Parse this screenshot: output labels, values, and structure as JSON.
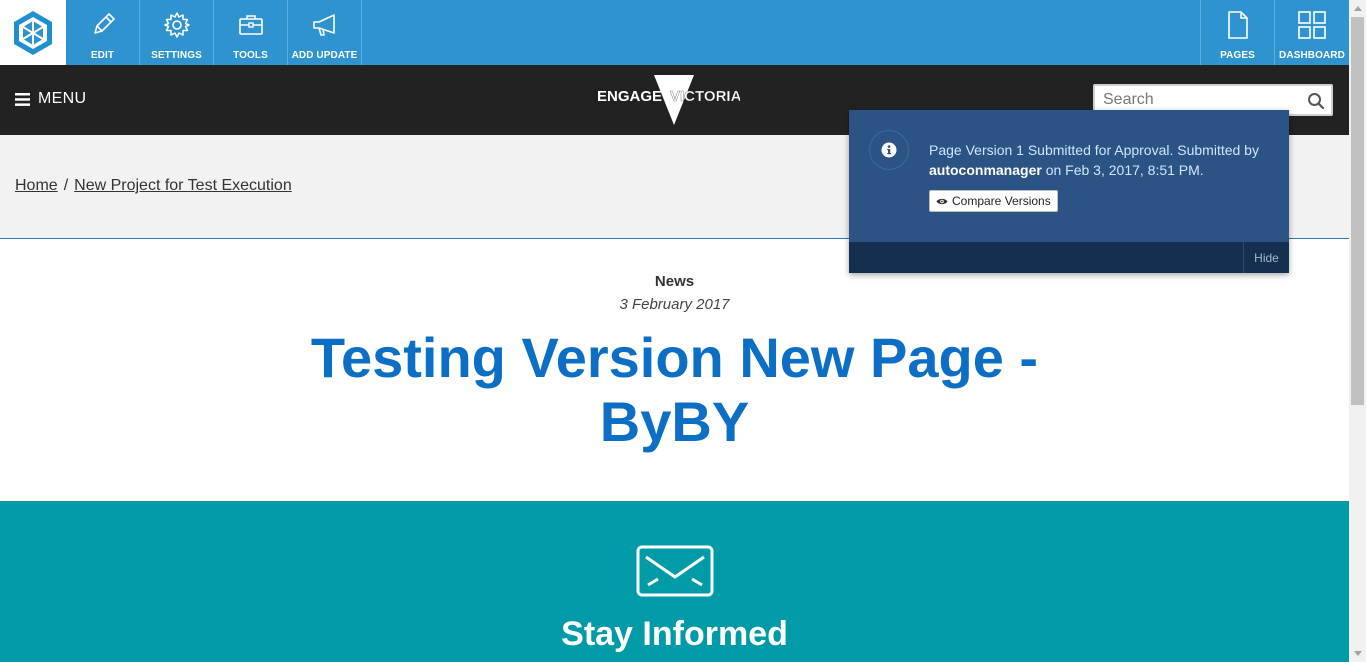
{
  "admin_toolbar": {
    "logo_icon": "engagement-hq-hexagon-logo-icon",
    "tools": [
      {
        "label": "EDIT",
        "icon": "pencil-icon"
      },
      {
        "label": "SETTINGS",
        "icon": "gear-icon"
      },
      {
        "label": "TOOLS",
        "icon": "toolbox-icon"
      },
      {
        "label": "ADD UPDATE",
        "icon": "megaphone-icon"
      }
    ],
    "right_tools": [
      {
        "label": "PAGES",
        "icon": "page-icon"
      },
      {
        "label": "DASHBOARD",
        "icon": "grid-icon"
      }
    ],
    "color": "#2e93cf"
  },
  "site_header": {
    "menu_label": "MENU",
    "logo_text_left": "ENGAGE",
    "logo_text_right": "VICTORIA",
    "search_placeholder": "Search",
    "background": "#222222"
  },
  "breadcrumb": {
    "items": [
      "Home",
      "New Project for Test Execution"
    ],
    "separator": "/"
  },
  "article": {
    "type": "News",
    "date": "3 February 2017",
    "title": "Testing Version New Page - ByBY",
    "title_color": "#0d6ec6"
  },
  "stay_informed": {
    "title": "Stay Informed",
    "icon": "envelope-icon",
    "background": "#009ba7"
  },
  "notification": {
    "text_before": "Page Version 1 Submitted for Approval. Submitted by ",
    "user": "autoconmanager",
    "text_after": " on Feb 3, 2017, 8:51 PM.",
    "compare_label": "Compare Versions",
    "hide_label": "Hide",
    "background": "#2b5384"
  }
}
